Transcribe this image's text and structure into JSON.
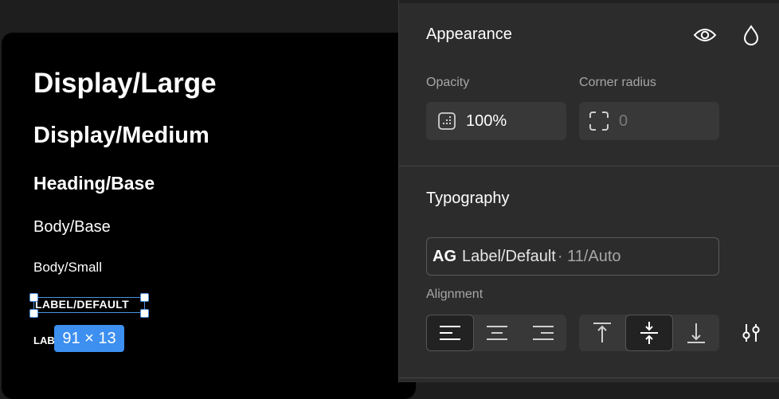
{
  "canvas": {
    "samples": [
      "Display/Large",
      "Display/Medium",
      "Heading/Base",
      "Body/Base",
      "Body/Small",
      "LABEL/DEFAULT",
      "LAB"
    ],
    "selection_size": "91 × 13"
  },
  "appearance": {
    "title": "Appearance",
    "opacity_label": "Opacity",
    "opacity_value": "100%",
    "corner_radius_label": "Corner radius",
    "corner_radius_value": "0",
    "icons": [
      "eye-icon",
      "drop-icon",
      "opacity-icon",
      "corner-radius-icon"
    ]
  },
  "typography": {
    "title": "Typography",
    "style_prefix": "AG",
    "style_name": "Label/Default",
    "style_meta": "· 11/Auto",
    "alignment_label": "Alignment",
    "horizontal_alignment": [
      "left",
      "center",
      "right"
    ],
    "horizontal_selected": "left",
    "vertical_alignment": [
      "top",
      "middle",
      "bottom"
    ],
    "vertical_selected": "middle"
  },
  "colors": {
    "canvas_bg": "#000000",
    "panel_bg": "#2c2c2c",
    "field_bg": "#383838",
    "selection": "#4a90e2",
    "badge": "#3d8ff0",
    "muted_text": "#a6a6a6"
  }
}
